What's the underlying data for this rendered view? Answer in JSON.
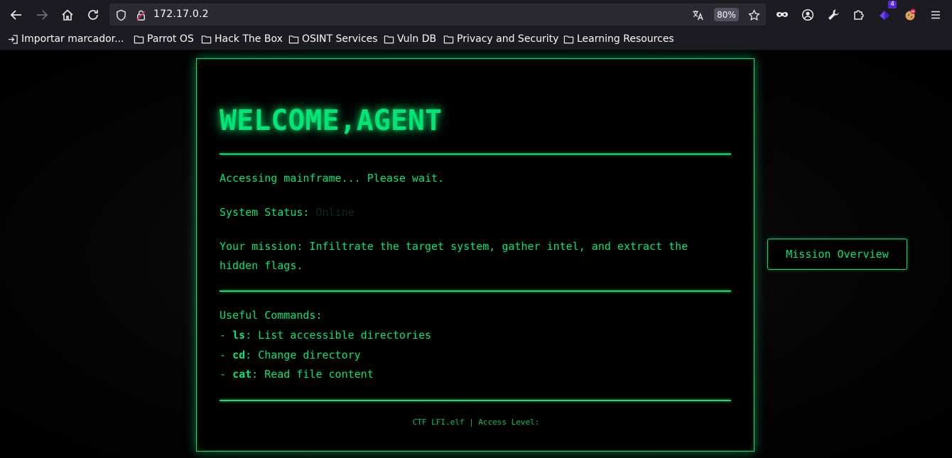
{
  "browser": {
    "url": "172.17.0.2",
    "zoom": "80%",
    "extension_badge": "4",
    "bookmarks": [
      "Importar marcador...",
      "Parrot OS",
      "Hack The Box",
      "OSINT Services",
      "Vuln DB",
      "Privacy and Security",
      "Learning Resources"
    ]
  },
  "page": {
    "title": "WELCOME,AGENT",
    "accessing": "Accessing mainframe... Please wait.",
    "status_label": "System Status:",
    "status_value": "Online",
    "mission_line1": "Your mission: Infiltrate the target system, gather intel, and extract the",
    "mission_line2": "hidden flags.",
    "commands_heading": "Useful Commands:",
    "commands": [
      {
        "prefix": "- ",
        "cmd": "ls",
        "desc": ": List accessible directories"
      },
      {
        "prefix": "- ",
        "cmd": "cd",
        "desc": ": Change directory"
      },
      {
        "prefix": "- ",
        "cmd": "cat",
        "desc": ": Read file content"
      }
    ],
    "footer": "CTF LFI.elf | Access Level:",
    "mission_button": "Mission Overview"
  },
  "colors": {
    "accent": "#00e676",
    "background": "#000000",
    "chrome": "#1c1b22"
  }
}
